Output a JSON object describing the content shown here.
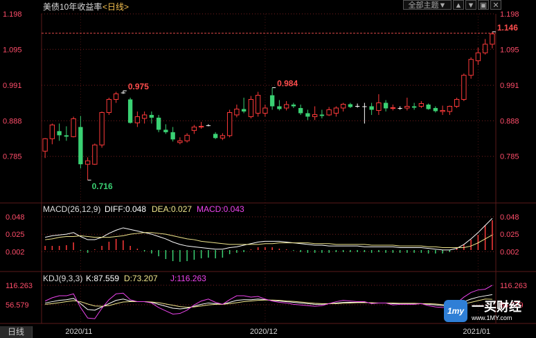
{
  "header": {
    "title": "美债10年收益率",
    "period_label": "<日线>",
    "theme_button": "全部主题▼",
    "up_icon": "arrow-up-icon",
    "down_icon": "arrow-down-icon",
    "layout_icon": "layout-icon",
    "close_icon": "close-icon"
  },
  "period_tab": "日线",
  "watermark": {
    "name": "一买财经",
    "url": "www.1MY.com",
    "logo": "1my"
  },
  "colors": {
    "up": "#ff3a3a",
    "down": "#3ad173",
    "doji": "#ffffff",
    "price_axis": "#ff4d6a",
    "grid": "#7a1f1f",
    "dif": "#ffffff",
    "dea": "#f0e68c",
    "macd": "#ee44ee",
    "k": "#ffffff",
    "d": "#f0e68c",
    "j": "#ee44ee",
    "current_line": "#e64a4a"
  },
  "chart_data": [
    {
      "type": "candlestick",
      "title": "美债10年收益率",
      "subtitle": "<日线>",
      "yticks": [
        "1.198",
        "1.095",
        "0.991",
        "0.888",
        "0.785"
      ],
      "ylim": [
        0.68,
        1.198
      ],
      "x_ticks": [
        {
          "index": 5,
          "label": "2020/11"
        },
        {
          "index": 31,
          "label": "2020/12"
        },
        {
          "index": 61,
          "label": "2021/01"
        }
      ],
      "current_value": "1.146",
      "annotations": [
        {
          "index": 11,
          "label": "0.975",
          "at": "high"
        },
        {
          "index": 6,
          "label": "0.716",
          "at": "low"
        },
        {
          "index": 32,
          "label": "0.984",
          "at": "high"
        },
        {
          "index": 63,
          "label": "1.146",
          "at": "high"
        }
      ],
      "candles": [
        {
          "o": 0.8,
          "h": 0.838,
          "l": 0.78,
          "c": 0.836
        },
        {
          "o": 0.836,
          "h": 0.88,
          "l": 0.82,
          "c": 0.876
        },
        {
          "o": 0.858,
          "h": 0.88,
          "l": 0.83,
          "c": 0.846
        },
        {
          "o": 0.846,
          "h": 0.872,
          "l": 0.83,
          "c": 0.842
        },
        {
          "o": 0.842,
          "h": 0.9,
          "l": 0.84,
          "c": 0.894
        },
        {
          "o": 0.87,
          "h": 0.902,
          "l": 0.75,
          "c": 0.762
        },
        {
          "o": 0.762,
          "h": 0.782,
          "l": 0.716,
          "c": 0.772
        },
        {
          "o": 0.762,
          "h": 0.822,
          "l": 0.76,
          "c": 0.818
        },
        {
          "o": 0.818,
          "h": 0.915,
          "l": 0.81,
          "c": 0.912
        },
        {
          "o": 0.912,
          "h": 0.955,
          "l": 0.905,
          "c": 0.95
        },
        {
          "o": 0.95,
          "h": 0.972,
          "l": 0.94,
          "c": 0.966
        },
        {
          "o": 0.97,
          "h": 0.975,
          "l": 0.966,
          "c": 0.97
        },
        {
          "o": 0.95,
          "h": 0.955,
          "l": 0.88,
          "c": 0.882
        },
        {
          "o": 0.882,
          "h": 0.915,
          "l": 0.87,
          "c": 0.9
        },
        {
          "o": 0.895,
          "h": 0.915,
          "l": 0.88,
          "c": 0.905
        },
        {
          "o": 0.905,
          "h": 0.915,
          "l": 0.88,
          "c": 0.897
        },
        {
          "o": 0.897,
          "h": 0.905,
          "l": 0.855,
          "c": 0.862
        },
        {
          "o": 0.862,
          "h": 0.878,
          "l": 0.85,
          "c": 0.855
        },
        {
          "o": 0.855,
          "h": 0.87,
          "l": 0.828,
          "c": 0.834
        },
        {
          "o": 0.825,
          "h": 0.84,
          "l": 0.82,
          "c": 0.83
        },
        {
          "o": 0.83,
          "h": 0.852,
          "l": 0.825,
          "c": 0.846
        },
        {
          "o": 0.86,
          "h": 0.876,
          "l": 0.85,
          "c": 0.87
        },
        {
          "o": 0.87,
          "h": 0.885,
          "l": 0.865,
          "c": 0.872
        },
        {
          "o": 0.875,
          "h": 0.878,
          "l": 0.872,
          "c": 0.875
        },
        {
          "o": 0.85,
          "h": 0.855,
          "l": 0.835,
          "c": 0.838
        },
        {
          "o": 0.838,
          "h": 0.852,
          "l": 0.832,
          "c": 0.845
        },
        {
          "o": 0.845,
          "h": 0.92,
          "l": 0.84,
          "c": 0.912
        },
        {
          "o": 0.905,
          "h": 0.935,
          "l": 0.898,
          "c": 0.922
        },
        {
          "o": 0.922,
          "h": 0.955,
          "l": 0.91,
          "c": 0.915
        },
        {
          "o": 0.9,
          "h": 0.96,
          "l": 0.895,
          "c": 0.95
        },
        {
          "o": 0.91,
          "h": 0.972,
          "l": 0.9,
          "c": 0.962
        },
        {
          "o": 0.91,
          "h": 0.935,
          "l": 0.9,
          "c": 0.925
        },
        {
          "o": 0.962,
          "h": 0.984,
          "l": 0.92,
          "c": 0.93
        },
        {
          "o": 0.93,
          "h": 0.948,
          "l": 0.918,
          "c": 0.922
        },
        {
          "o": 0.925,
          "h": 0.945,
          "l": 0.918,
          "c": 0.935
        },
        {
          "o": 0.935,
          "h": 0.94,
          "l": 0.925,
          "c": 0.93
        },
        {
          "o": 0.925,
          "h": 0.935,
          "l": 0.905,
          "c": 0.91
        },
        {
          "o": 0.91,
          "h": 0.92,
          "l": 0.89,
          "c": 0.9
        },
        {
          "o": 0.9,
          "h": 0.93,
          "l": 0.89,
          "c": 0.906
        },
        {
          "o": 0.906,
          "h": 0.92,
          "l": 0.895,
          "c": 0.902
        },
        {
          "o": 0.905,
          "h": 0.928,
          "l": 0.902,
          "c": 0.92
        },
        {
          "o": 0.91,
          "h": 0.93,
          "l": 0.9,
          "c": 0.925
        },
        {
          "o": 0.925,
          "h": 0.94,
          "l": 0.915,
          "c": 0.936
        },
        {
          "o": 0.936,
          "h": 0.94,
          "l": 0.925,
          "c": 0.928
        },
        {
          "o": 0.93,
          "h": 0.938,
          "l": 0.926,
          "c": 0.931
        },
        {
          "o": 0.93,
          "h": 0.94,
          "l": 0.88,
          "c": 0.93
        },
        {
          "o": 0.93,
          "h": 0.94,
          "l": 0.905,
          "c": 0.92
        },
        {
          "o": 0.918,
          "h": 0.965,
          "l": 0.905,
          "c": 0.94
        },
        {
          "o": 0.94,
          "h": 0.948,
          "l": 0.915,
          "c": 0.924
        },
        {
          "o": 0.924,
          "h": 0.935,
          "l": 0.918,
          "c": 0.926
        },
        {
          "o": 0.925,
          "h": 0.93,
          "l": 0.92,
          "c": 0.925
        },
        {
          "o": 0.925,
          "h": 0.955,
          "l": 0.918,
          "c": 0.93
        },
        {
          "o": 0.93,
          "h": 0.94,
          "l": 0.92,
          "c": 0.926
        },
        {
          "o": 0.93,
          "h": 0.945,
          "l": 0.925,
          "c": 0.938
        },
        {
          "o": 0.935,
          "h": 0.938,
          "l": 0.92,
          "c": 0.922
        },
        {
          "o": 0.925,
          "h": 0.93,
          "l": 0.912,
          "c": 0.916
        },
        {
          "o": 0.915,
          "h": 0.932,
          "l": 0.905,
          "c": 0.918
        },
        {
          "o": 0.915,
          "h": 0.932,
          "l": 0.905,
          "c": 0.93
        },
        {
          "o": 0.93,
          "h": 0.955,
          "l": 0.925,
          "c": 0.95
        },
        {
          "o": 0.95,
          "h": 1.025,
          "l": 0.945,
          "c": 1.02
        },
        {
          "o": 1.02,
          "h": 1.072,
          "l": 1.01,
          "c": 1.066
        },
        {
          "o": 1.062,
          "h": 1.1,
          "l": 1.05,
          "c": 1.085
        },
        {
          "o": 1.085,
          "h": 1.125,
          "l": 1.08,
          "c": 1.11
        },
        {
          "o": 1.11,
          "h": 1.146,
          "l": 1.098,
          "c": 1.14
        }
      ]
    },
    {
      "type": "macd",
      "legend_name": "MACD(26,12,9)",
      "values": [
        {
          "name": "DIFF",
          "label": "DIFF:0.048",
          "value": 0.048
        },
        {
          "name": "DEA",
          "label": "DEA:0.027",
          "value": 0.027
        },
        {
          "name": "MACD",
          "label": "MACD:0.043",
          "value": 0.043
        }
      ],
      "yticks": [
        "0.048",
        "0.025",
        "0.002"
      ],
      "ylim": [
        -0.02,
        0.048
      ],
      "histogram": [
        0.006,
        0.006,
        0.006,
        0.007,
        0.011,
        -0.001,
        -0.004,
        0.001,
        0.006,
        0.012,
        0.016,
        0.014,
        0.006,
        0.002,
        -0.002,
        -0.005,
        -0.009,
        -0.013,
        -0.016,
        -0.017,
        -0.016,
        -0.014,
        -0.012,
        -0.011,
        -0.012,
        -0.011,
        -0.006,
        -0.004,
        -0.003,
        0.001,
        0.004,
        0.004,
        0.004,
        0.002,
        0.001,
        -0.001,
        -0.003,
        -0.004,
        -0.004,
        -0.004,
        -0.004,
        -0.003,
        -0.003,
        -0.003,
        -0.003,
        -0.003,
        -0.004,
        -0.003,
        -0.004,
        -0.004,
        -0.004,
        -0.004,
        -0.004,
        -0.004,
        -0.005,
        -0.005,
        -0.005,
        -0.003,
        0.002,
        0.008,
        0.015,
        0.022,
        0.036,
        0.043
      ],
      "diff": [
        0.024,
        0.026,
        0.027,
        0.028,
        0.03,
        0.025,
        0.021,
        0.021,
        0.024,
        0.029,
        0.033,
        0.036,
        0.034,
        0.032,
        0.03,
        0.028,
        0.025,
        0.022,
        0.018,
        0.015,
        0.013,
        0.012,
        0.011,
        0.01,
        0.009,
        0.009,
        0.011,
        0.012,
        0.014,
        0.016,
        0.018,
        0.019,
        0.019,
        0.019,
        0.018,
        0.017,
        0.016,
        0.015,
        0.014,
        0.014,
        0.013,
        0.013,
        0.013,
        0.013,
        0.013,
        0.012,
        0.012,
        0.012,
        0.012,
        0.012,
        0.011,
        0.011,
        0.011,
        0.011,
        0.01,
        0.009,
        0.008,
        0.008,
        0.01,
        0.015,
        0.022,
        0.03,
        0.039,
        0.048
      ],
      "dea": [
        0.021,
        0.022,
        0.024,
        0.025,
        0.025,
        0.026,
        0.025,
        0.024,
        0.024,
        0.024,
        0.025,
        0.026,
        0.028,
        0.029,
        0.03,
        0.03,
        0.029,
        0.028,
        0.026,
        0.024,
        0.022,
        0.021,
        0.019,
        0.018,
        0.017,
        0.016,
        0.015,
        0.015,
        0.015,
        0.015,
        0.015,
        0.016,
        0.016,
        0.017,
        0.017,
        0.017,
        0.017,
        0.017,
        0.016,
        0.016,
        0.016,
        0.015,
        0.015,
        0.015,
        0.015,
        0.015,
        0.014,
        0.014,
        0.014,
        0.014,
        0.013,
        0.013,
        0.013,
        0.013,
        0.012,
        0.012,
        0.011,
        0.011,
        0.011,
        0.011,
        0.013,
        0.017,
        0.022,
        0.027
      ]
    },
    {
      "type": "kdj",
      "legend_name": "KDJ(9,3,3)",
      "values": [
        {
          "name": "K",
          "label": "K:87.559",
          "value": 87.559
        },
        {
          "name": "D",
          "label": "D:73.207",
          "value": 73.207
        },
        {
          "name": "J",
          "label": "J:116.263",
          "value": 116.263
        }
      ],
      "yticks": [
        "116.263",
        "56.579"
      ],
      "ylim": [
        10,
        118
      ],
      "k": [
        62,
        66,
        70,
        72,
        76,
        60,
        42,
        40,
        50,
        60,
        70,
        74,
        68,
        66,
        66,
        64,
        58,
        52,
        46,
        44,
        46,
        52,
        58,
        62,
        60,
        58,
        64,
        70,
        72,
        72,
        74,
        72,
        70,
        68,
        66,
        64,
        62,
        60,
        58,
        58,
        60,
        62,
        64,
        64,
        64,
        64,
        62,
        62,
        62,
        60,
        60,
        60,
        60,
        60,
        58,
        56,
        54,
        54,
        58,
        66,
        74,
        80,
        84,
        87.559
      ],
      "d": [
        58,
        60,
        63,
        66,
        69,
        66,
        59,
        53,
        52,
        54,
        60,
        65,
        66,
        66,
        66,
        65,
        63,
        59,
        55,
        51,
        49,
        50,
        53,
        56,
        58,
        58,
        60,
        63,
        66,
        68,
        70,
        71,
        71,
        70,
        68,
        67,
        65,
        63,
        61,
        60,
        60,
        60,
        61,
        62,
        63,
        63,
        63,
        62,
        62,
        62,
        61,
        61,
        61,
        60,
        60,
        59,
        57,
        55,
        56,
        59,
        64,
        69,
        74,
        73.207
      ],
      "j": [
        68,
        78,
        84,
        84,
        90,
        48,
        16,
        14,
        46,
        72,
        90,
        92,
        72,
        66,
        66,
        62,
        48,
        38,
        28,
        30,
        40,
        56,
        68,
        74,
        64,
        58,
        72,
        84,
        84,
        80,
        82,
        74,
        68,
        64,
        62,
        58,
        56,
        54,
        52,
        54,
        60,
        66,
        70,
        68,
        66,
        66,
        60,
        62,
        62,
        56,
        58,
        58,
        58,
        60,
        54,
        50,
        48,
        52,
        62,
        80,
        94,
        102,
        104,
        116.263
      ]
    }
  ]
}
